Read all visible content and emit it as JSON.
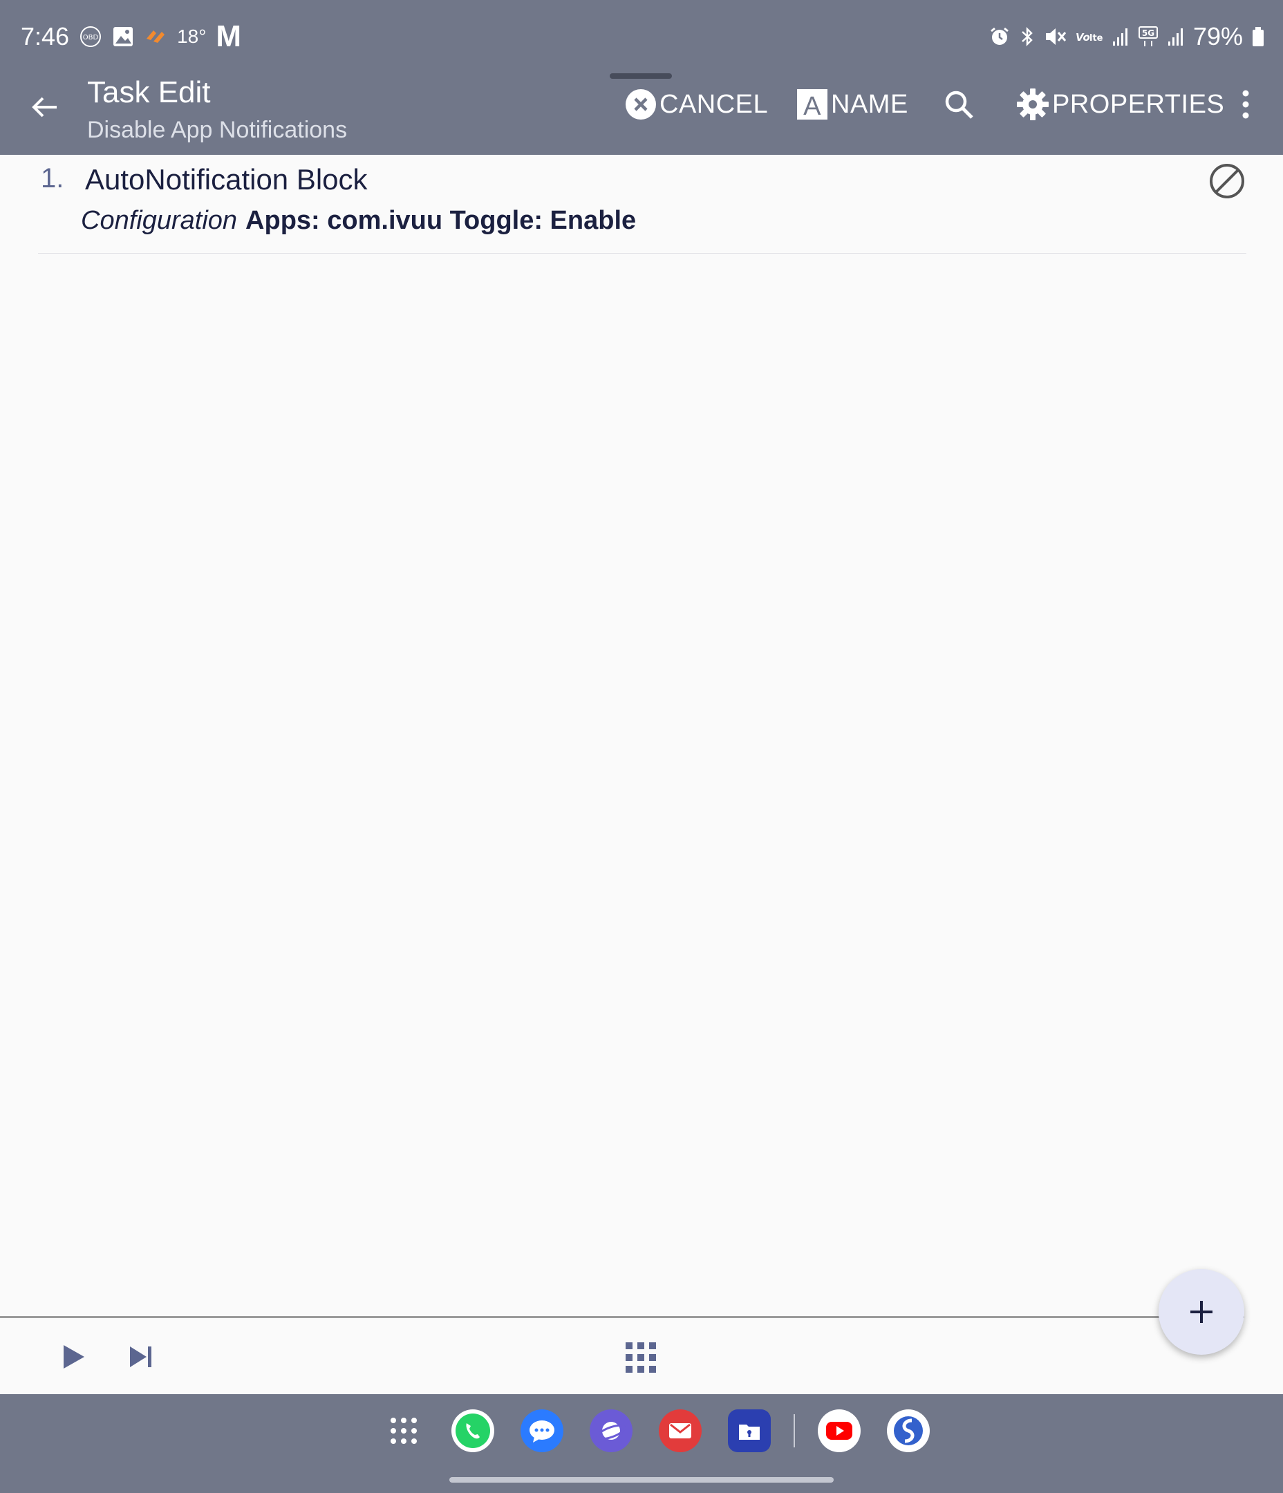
{
  "status_bar": {
    "time": "7:46",
    "temperature": "18°",
    "gmail_letter": "M",
    "battery": "79%",
    "left_icons": [
      "obd-icon",
      "gallery-icon",
      "weather-app-icon"
    ],
    "right_icons": [
      "alarm-icon",
      "bluetooth-icon",
      "mute-icon",
      "volte-icon",
      "signal-icon",
      "5g-icon",
      "signal-icon",
      "battery-icon"
    ]
  },
  "app_bar": {
    "title": "Task Edit",
    "subtitle": "Disable App Notifications",
    "actions": {
      "cancel": "CANCEL",
      "name": "NAME",
      "properties": "PROPERTIES"
    }
  },
  "actions_list": [
    {
      "number": "1.",
      "title": "AutoNotification Block",
      "config_label": "Configuration",
      "config_value": "Apps: com.ivuu Toggle: Enable"
    }
  ],
  "colors": {
    "bar": "#717789",
    "accent": "#5c6690",
    "fab": "#e4e6f6"
  },
  "dock_apps": [
    "app-drawer-icon",
    "whatsapp-icon",
    "messages-icon",
    "internet-icon",
    "email-icon",
    "secure-folder-icon",
    "youtube-icon",
    "simplenote-icon"
  ]
}
